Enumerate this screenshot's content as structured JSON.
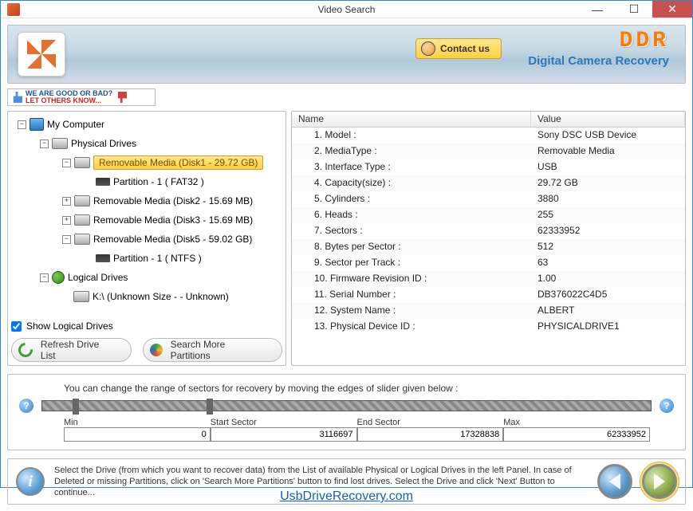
{
  "window": {
    "title": "Video Search"
  },
  "header": {
    "contact_label": "Contact us",
    "brand_logo": "DDR",
    "brand_tagline": "Digital Camera Recovery"
  },
  "rating": {
    "line1": "WE ARE GOOD OR BAD?",
    "line2": "LET OTHERS KNOW..."
  },
  "tree": {
    "root": "My Computer",
    "physical_label": "Physical Drives",
    "disk1": "Removable Media (Disk1 - 29.72 GB)",
    "disk1_part": "Partition - 1 ( FAT32 )",
    "disk2": "Removable Media (Disk2 - 15.69 MB)",
    "disk3": "Removable Media (Disk3 - 15.69 MB)",
    "disk5": "Removable Media (Disk5 - 59.02 GB)",
    "disk5_part": "Partition - 1 ( NTFS )",
    "logical_label": "Logical Drives",
    "logical_k": "K:\\ (Unknown Size  -  - Unknown)"
  },
  "show_logical_label": "Show Logical Drives",
  "btn_refresh": "Refresh Drive List",
  "btn_search_more": "Search More Partitions",
  "grid": {
    "header_name": "Name",
    "header_value": "Value",
    "rows": [
      {
        "name": "1. Model :",
        "value": "Sony DSC USB Device"
      },
      {
        "name": "2. MediaType :",
        "value": "Removable Media"
      },
      {
        "name": "3. Interface Type :",
        "value": "USB"
      },
      {
        "name": "4. Capacity(size) :",
        "value": "29.72 GB"
      },
      {
        "name": "5. Cylinders :",
        "value": "3880"
      },
      {
        "name": "6. Heads :",
        "value": "255"
      },
      {
        "name": "7. Sectors :",
        "value": "62333952"
      },
      {
        "name": "8. Bytes per Sector :",
        "value": "512"
      },
      {
        "name": "9. Sector per Track :",
        "value": "63"
      },
      {
        "name": "10. Firmware Revision ID :",
        "value": "1.00"
      },
      {
        "name": "11. Serial Number :",
        "value": "DB376022C4D5"
      },
      {
        "name": "12. System Name :",
        "value": "ALBERT"
      },
      {
        "name": "13. Physical Device ID :",
        "value": "PHYSICALDRIVE1"
      }
    ]
  },
  "sector": {
    "instruction": "You can change the range of sectors for recovery by moving the edges of slider given below :",
    "min_label": "Min",
    "start_label": "Start Sector",
    "end_label": "End Sector",
    "max_label": "Max",
    "min": "0",
    "start": "3116697",
    "end": "17328838",
    "max": "62333952"
  },
  "info_text": "Select the Drive (from which you want to recover data) from the List of available Physical or Logical Drives in the left Panel. In case of Deleted or missing Partitions, click on 'Search More Partitions' button to find lost drives. Select the Drive and click 'Next' Button to continue...",
  "footer_link": "UsbDriveRecovery.com"
}
